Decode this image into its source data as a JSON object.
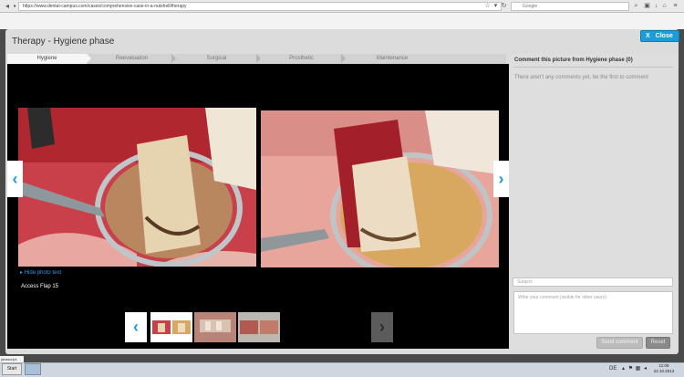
{
  "browser": {
    "url": "https://www.dental-campus.com/cases/comprehensive-case-in-a-nutshell/therapy",
    "search_placeholder": "Google",
    "tooltip": "javascript:"
  },
  "modal": {
    "title": "Therapy - Hygiene phase",
    "close_label": "Close"
  },
  "tabs": [
    {
      "label": "Hygiene",
      "active": true
    },
    {
      "label": "Reevaluation",
      "active": false
    },
    {
      "label": "Surgical",
      "active": false
    },
    {
      "label": "Prosthetic",
      "active": false
    },
    {
      "label": "Maintenance",
      "active": false
    }
  ],
  "viewer": {
    "hide_photo_text": "Hide photo text",
    "caption": "Access Flap 15"
  },
  "comments": {
    "heading": "Comment this picture from Hygiene phase (0)",
    "empty_text": "There aren't any comments yet, be the first to comment",
    "subject_placeholder": "Subject",
    "comment_placeholder": "Write your comment (visible for other users)",
    "send_label": "Send comment",
    "reset_label": "Reset"
  },
  "taskbar": {
    "start_label": "Start",
    "lang": "DE",
    "time": "11:06",
    "date": "22.10.2013"
  },
  "colors": {
    "accent": "#1b9ed8",
    "viewer_bg": "#000000"
  }
}
